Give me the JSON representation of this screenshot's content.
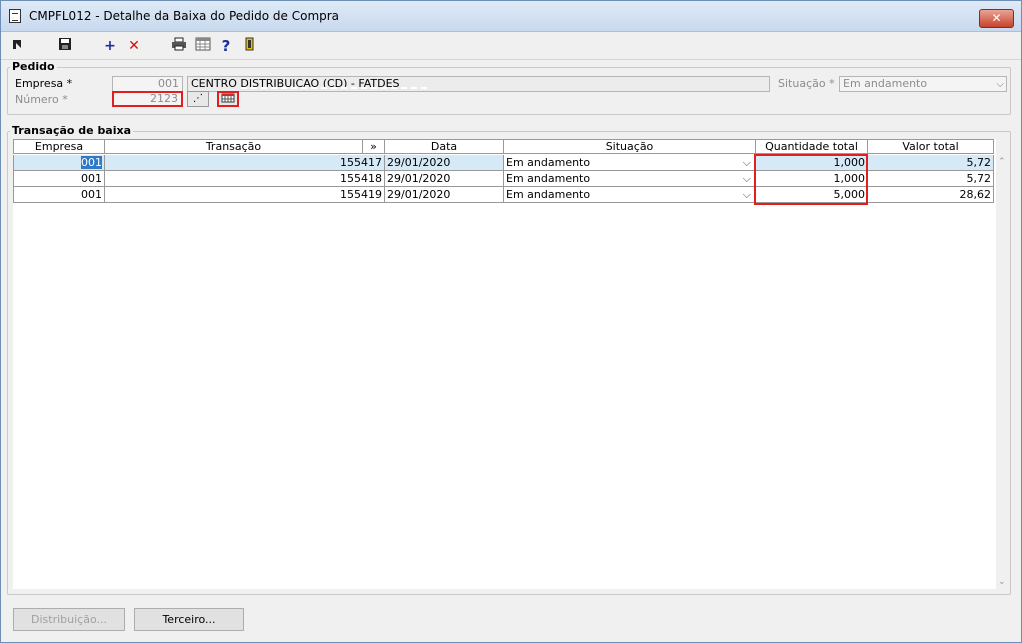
{
  "window": {
    "title": "CMPFL012 - Detalhe da Baixa do Pedido de Compra",
    "close": "✕"
  },
  "pedido": {
    "legend": "Pedido",
    "empresa_label": "Empresa *",
    "empresa_code": "001",
    "empresa_name": "CENTRO DISTRIBUICAO (CD) - FATDES",
    "numero_label": "Número *",
    "numero_value": "2123",
    "situacao_label": "Situação *",
    "situacao_value": "Em andamento"
  },
  "transacao": {
    "legend": "Transação de baixa",
    "columns": [
      "Empresa",
      "Transação",
      "»",
      "Data",
      "Situação",
      "Quantidade total",
      "Valor total"
    ],
    "rows": [
      {
        "empresa": "001",
        "transacao": "155417",
        "data": "29/01/2020",
        "situacao": "Em andamento",
        "quantidade": "1,000",
        "valor": "5,72"
      },
      {
        "empresa": "001",
        "transacao": "155418",
        "data": "29/01/2020",
        "situacao": "Em andamento",
        "quantidade": "1,000",
        "valor": "5,72"
      },
      {
        "empresa": "001",
        "transacao": "155419",
        "data": "29/01/2020",
        "situacao": "Em andamento",
        "quantidade": "5,000",
        "valor": "28,62"
      }
    ]
  },
  "buttons": {
    "distribuicao": "Distribuição...",
    "terceiro": "Terceiro..."
  },
  "icons": {
    "first": "cursor-icon",
    "save": "save-icon",
    "add": "plus-icon",
    "delete": "delete-icon",
    "print": "print-icon",
    "grid": "grid-icon",
    "help": "help-icon",
    "exit": "exit-icon"
  },
  "colors": {
    "error": "#e02020",
    "selected_row": "#d5e9f7"
  }
}
